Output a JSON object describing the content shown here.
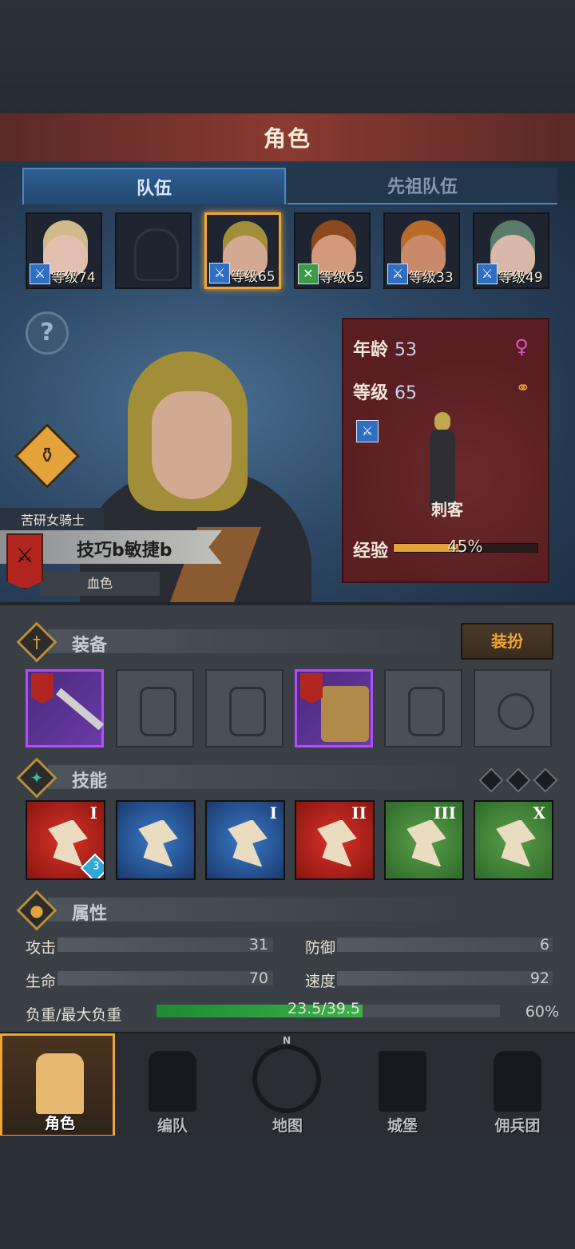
{
  "header": {
    "title": "角色"
  },
  "tabs": [
    {
      "label": "队伍",
      "active": true
    },
    {
      "label": "先祖队伍",
      "active": false
    }
  ],
  "team": [
    {
      "level": "等级74",
      "class_icon": "sword-icon",
      "hair": "#d0b98a",
      "skin": "#e2bfae"
    },
    {
      "level": "",
      "empty": true
    },
    {
      "level": "等级65",
      "class_icon": "sword-icon",
      "hair": "#a28e38",
      "skin": "#d2aa92",
      "selected": true
    },
    {
      "level": "等级65",
      "class_icon": "shield-icon",
      "hair": "#8a4a1e",
      "skin": "#d29a7a"
    },
    {
      "level": "等级33",
      "class_icon": "sword-icon",
      "hair": "#b86a2a",
      "skin": "#c88a6a"
    },
    {
      "level": "等级49",
      "class_icon": "sword-icon",
      "hair": "#5a7a6a",
      "skin": "#d8b8a6"
    }
  ],
  "character": {
    "title": "苦研女骑士",
    "traits": "技巧b敏捷b",
    "bloodline": "血色",
    "age_label": "年龄",
    "age": "53",
    "level_label": "等级",
    "level": "65",
    "class_name": "刺客",
    "xp_label": "经验",
    "xp_percent": "45%",
    "xp_fraction": 0.45
  },
  "equipment": {
    "section": "装备",
    "dress_button": "装扮",
    "slots": [
      {
        "name": "weapon",
        "filled": true,
        "rarity": "epic"
      },
      {
        "name": "shield",
        "filled": false
      },
      {
        "name": "helmet",
        "filled": false
      },
      {
        "name": "armor",
        "filled": true,
        "rarity": "epic"
      },
      {
        "name": "boots",
        "filled": false
      },
      {
        "name": "ring",
        "filled": false
      }
    ]
  },
  "skills": {
    "section": "技能",
    "items": [
      {
        "rank": "I",
        "color": "red",
        "badge": "3"
      },
      {
        "rank": "",
        "color": "blue"
      },
      {
        "rank": "I",
        "color": "blue"
      },
      {
        "rank": "II",
        "color": "red"
      },
      {
        "rank": "III",
        "color": "green"
      },
      {
        "rank": "X",
        "color": "green"
      }
    ]
  },
  "attributes": {
    "section": "属性",
    "attack_label": "攻击",
    "attack": "31",
    "defense_label": "防御",
    "defense": "6",
    "hp_label": "生命",
    "hp": "70",
    "speed_label": "速度",
    "speed": "92",
    "load_label": "负重/最大负重",
    "load": "23.5/39.5",
    "load_percent": "60%",
    "load_fraction": 0.6
  },
  "nav": [
    {
      "label": "角色",
      "active": true
    },
    {
      "label": "编队",
      "active": false
    },
    {
      "label": "地图",
      "active": false
    },
    {
      "label": "城堡",
      "active": false
    },
    {
      "label": "佣兵团",
      "active": false
    }
  ],
  "compass_n": "N",
  "colors": {
    "accent": "#f0a534",
    "epic": "#b14cff",
    "card": "#5a1e22"
  }
}
